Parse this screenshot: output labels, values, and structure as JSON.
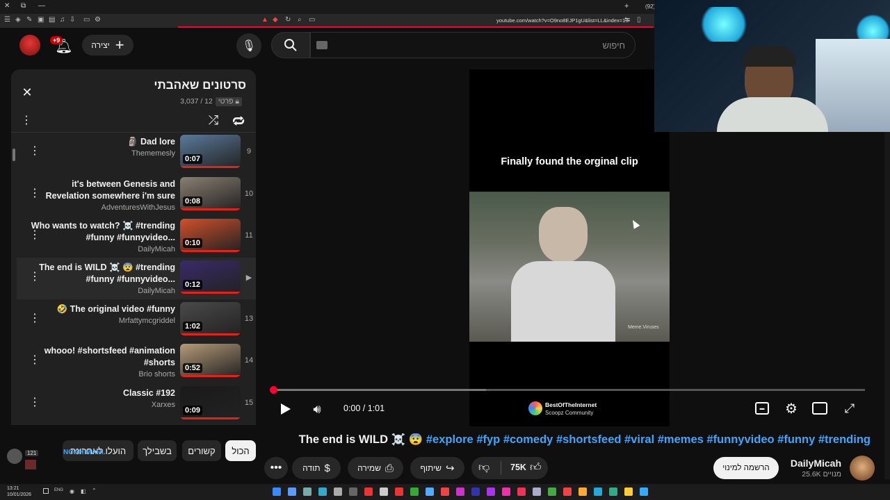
{
  "browser": {
    "url": "youtube.com/watch?v=O9no8EJP1gU&list=LL&index=13",
    "tab_counter": "(92)"
  },
  "header": {
    "search_placeholder": "חיפוש",
    "create_label": "יצירה",
    "notif_badge": "+9"
  },
  "playlist": {
    "title": "סרטונים שאהבתי",
    "meta": "3,037 / 12",
    "privacy": "פרטי",
    "items": [
      {
        "index": "9",
        "title": "🗿 Dad lore",
        "channel": "Thememesly",
        "duration": "0:07",
        "thumb_color": "#5a7a9a"
      },
      {
        "index": "10",
        "title": "it's between Genesis and Revelation somewhere i'm sure",
        "channel": "AdventuresWithJesus",
        "duration": "0:08",
        "thumb_color": "#8a7f72"
      },
      {
        "index": "11",
        "title": "Who wants to watch? ☠️ #trending #funny #funnyvideo...",
        "channel": "DailyMicah",
        "duration": "0:10",
        "thumb_color": "#d0502a"
      },
      {
        "index": "▶",
        "title": "The end is WILD ☠️ 😨 #trending #funny #funnyvideo...",
        "channel": "DailyMicah",
        "duration": "0:12",
        "thumb_color": "#3a2a6a"
      },
      {
        "index": "13",
        "title": "🤣 The original video #funny",
        "channel": "Mrfattymcgriddel",
        "duration": "1:02",
        "thumb_color": "#4a4a4a"
      },
      {
        "index": "14",
        "title": "whooo! #shortsfeed #animation #shorts",
        "channel": "Brio shorts",
        "duration": "0:52",
        "thumb_color": "#b59a78"
      },
      {
        "index": "15",
        "title": "Classic #192",
        "channel": "Xarxes",
        "duration": "0:09",
        "thumb_color": "#1a1a1a"
      }
    ]
  },
  "filters": {
    "all": "הכול",
    "related": "קשורים",
    "for_you": "בשבילך",
    "recent": "הועלו לאחרונה"
  },
  "stream_overlay": {
    "followers": "121",
    "name": "NOAH MARI..."
  },
  "player": {
    "caption": "Finally found the orginal clip",
    "time": "0:00 / 1:01",
    "watermark": "Meme.Viruses",
    "community_name": "BestOfTheInternet",
    "community_sub": "Scoopz Community",
    "progress": 0.0
  },
  "video": {
    "title_start": "The end is WILD ☠️ 😨",
    "hashtags": "#explore #fyp #comedy #shortsfeed #viral #memes #funnyvideo #funny #trending",
    "channel": "DailyMicah",
    "subscribers": "25.6K מנויים",
    "subscribe_label": "הרשמה למינוי",
    "likes": "75K",
    "share_label": "שיתוף",
    "save_label": "שמירה",
    "thanks_label": "תודה"
  },
  "taskbar": {
    "time": "13:21",
    "date": "10/01/2026",
    "lang": "ENG"
  },
  "colors": {
    "accent_red": "#ff0033",
    "hashtag_blue": "#3ea6ff"
  }
}
